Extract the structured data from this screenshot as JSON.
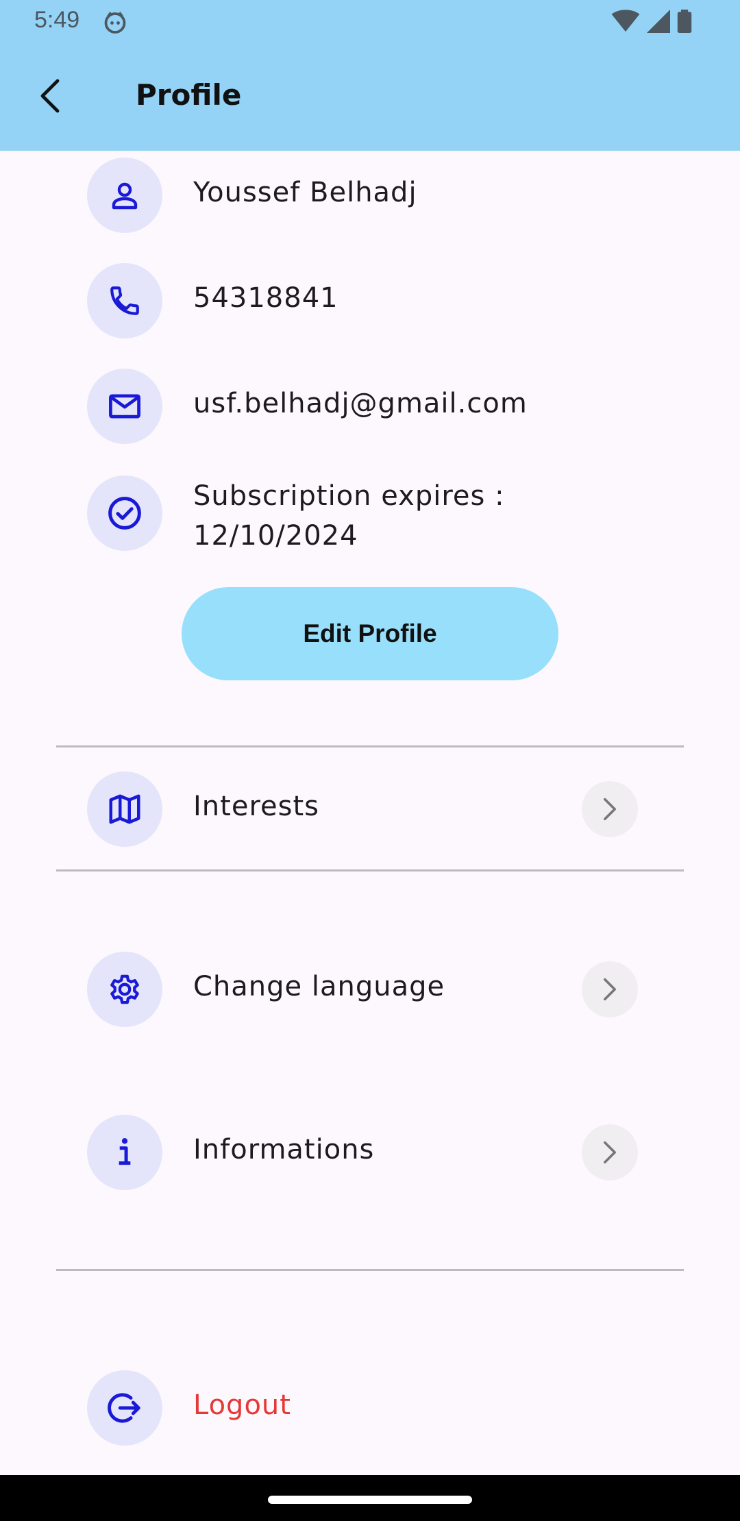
{
  "status": {
    "time": "5:49"
  },
  "appbar": {
    "title": "Profile"
  },
  "profile": {
    "name": "Youssef Belhadj",
    "phone": "54318841",
    "email": "usf.belhadj@gmail.com",
    "subscription_line1": "Subscription expires :",
    "subscription_line2": "12/10/2024"
  },
  "edit_button": {
    "label": "Edit Profile"
  },
  "menu": {
    "interests": "Interests",
    "change_language": "Change language",
    "informations": "Informations",
    "logout": "Logout"
  },
  "colors": {
    "appbar": "#94d3f5",
    "icon": "#1a1ad6",
    "icon_bg": "#e4e5fa",
    "button": "#98dffc",
    "logout": "#e53935"
  },
  "icons": [
    "back-arrow",
    "person",
    "phone",
    "mail",
    "check-circle",
    "map",
    "gear",
    "info",
    "logout",
    "chevron-right"
  ]
}
